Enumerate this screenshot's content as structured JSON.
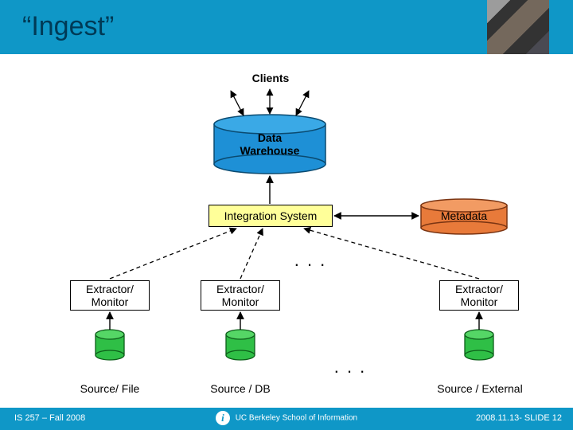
{
  "header": {
    "title": "“Ingest”"
  },
  "labels": {
    "clients": "Clients",
    "warehouse_l1": "Data",
    "warehouse_l2": "Warehouse",
    "integration": "Integration System",
    "metadata": "Metadata",
    "ellipsis_top": ". . .",
    "ellipsis_mid": ". . .",
    "extractor_l1": "Extractor/",
    "extractor_l2": "Monitor",
    "source1": "Source/ File",
    "source2": "Source / DB",
    "source3": "Source / External"
  },
  "footer": {
    "left": "IS 257 – Fall 2008",
    "center_brand": "UC Berkeley School of Information",
    "right": "2008.11.13- SLIDE 12"
  },
  "chart_data": {
    "type": "diagram",
    "title": "Ingest",
    "nodes": [
      {
        "id": "clients",
        "label": "Clients",
        "kind": "label"
      },
      {
        "id": "warehouse",
        "label": "Data Warehouse",
        "kind": "cylinder",
        "color": "#1e90d6"
      },
      {
        "id": "integration",
        "label": "Integration System",
        "kind": "box",
        "color": "#ffff99"
      },
      {
        "id": "metadata",
        "label": "Metadata",
        "kind": "cylinder",
        "color": "#e87a3a"
      },
      {
        "id": "ext1",
        "label": "Extractor/Monitor",
        "kind": "box"
      },
      {
        "id": "ext2",
        "label": "Extractor/Monitor",
        "kind": "box"
      },
      {
        "id": "ext3",
        "label": "Extractor/Monitor",
        "kind": "box"
      },
      {
        "id": "src1",
        "label": "Source/ File",
        "kind": "cylinder",
        "color": "#2fbf46"
      },
      {
        "id": "src2",
        "label": "Source / DB",
        "kind": "cylinder",
        "color": "#2fbf46"
      },
      {
        "id": "src3",
        "label": "Source / External",
        "kind": "cylinder",
        "color": "#2fbf46"
      }
    ],
    "edges": [
      {
        "from": "warehouse",
        "to": "clients",
        "style": "solid",
        "bidir": true,
        "count": 3
      },
      {
        "from": "integration",
        "to": "warehouse",
        "style": "solid"
      },
      {
        "from": "integration",
        "to": "metadata",
        "style": "solid",
        "bidir": true
      },
      {
        "from": "ext1",
        "to": "integration",
        "style": "dashed"
      },
      {
        "from": "ext2",
        "to": "integration",
        "style": "dashed"
      },
      {
        "from": "ext3",
        "to": "integration",
        "style": "dashed"
      },
      {
        "from": "src1",
        "to": "ext1",
        "style": "solid"
      },
      {
        "from": "src2",
        "to": "ext2",
        "style": "solid"
      },
      {
        "from": "src3",
        "to": "ext3",
        "style": "solid"
      }
    ]
  }
}
